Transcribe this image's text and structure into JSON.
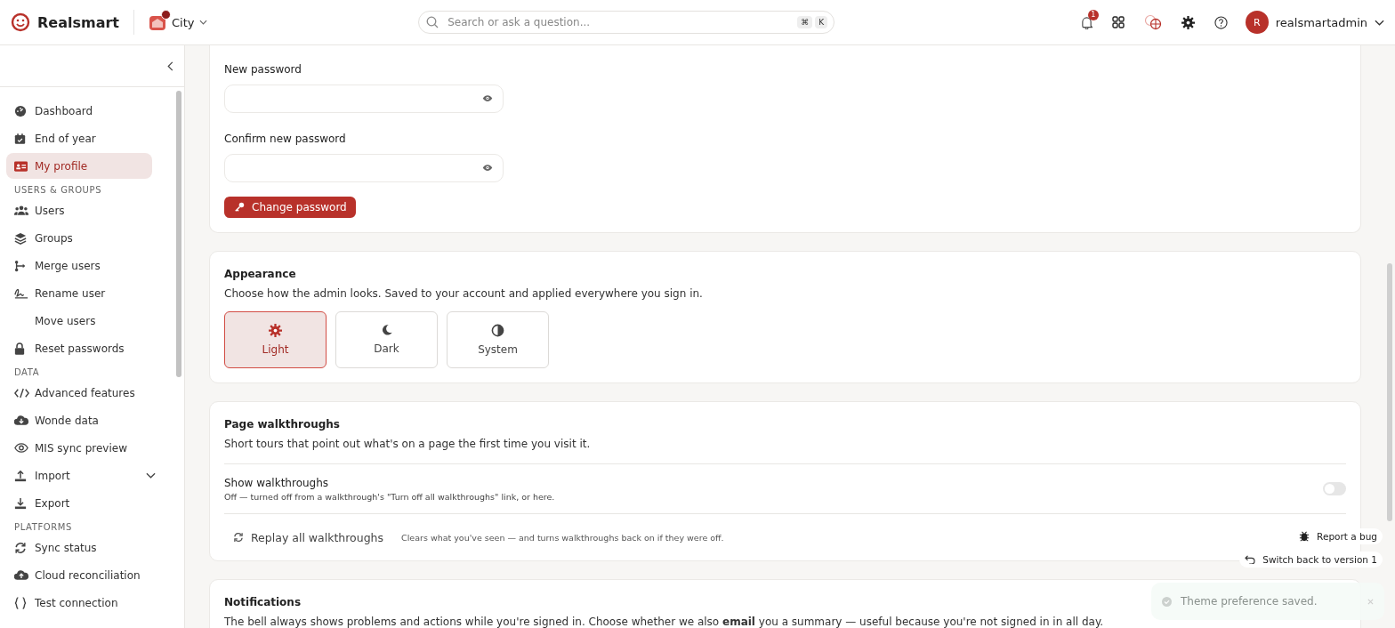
{
  "brand": {
    "name": "Realsmart"
  },
  "school": {
    "name": "City",
    "alert": true
  },
  "search": {
    "placeholder": "Search or ask a question...",
    "keys": [
      "⌘",
      "K"
    ]
  },
  "notifications": {
    "count": "1"
  },
  "user": {
    "initial": "R",
    "name": "realsmartadmin"
  },
  "sidebar": {
    "sections": [
      {
        "items": [
          {
            "label": "Dashboard",
            "kind": "link",
            "selected": false
          },
          {
            "label": "End of year",
            "kind": "link",
            "selected": false
          },
          {
            "label": "My profile",
            "kind": "link",
            "selected": true
          }
        ]
      },
      {
        "heading": "USERS & GROUPS",
        "items": [
          {
            "label": "Users",
            "kind": "link",
            "selected": false
          },
          {
            "label": "Groups",
            "kind": "link",
            "selected": false
          },
          {
            "label": "Merge users",
            "kind": "link",
            "selected": false
          },
          {
            "label": "Rename user",
            "kind": "link",
            "selected": false
          },
          {
            "label": "Move users",
            "kind": "link",
            "selected": false
          },
          {
            "label": "Reset passwords",
            "kind": "link",
            "selected": false
          }
        ]
      },
      {
        "heading": "DATA",
        "items": [
          {
            "label": "Advanced features",
            "kind": "link",
            "selected": false
          },
          {
            "label": "Wonde data",
            "kind": "link",
            "selected": false
          },
          {
            "label": "MIS sync preview",
            "kind": "link",
            "selected": false
          },
          {
            "label": "Import",
            "kind": "group",
            "selected": false
          },
          {
            "label": "Export",
            "kind": "link",
            "selected": false
          }
        ]
      },
      {
        "heading": "PLATFORMS",
        "items": [
          {
            "label": "Sync status",
            "kind": "link",
            "selected": false
          },
          {
            "label": "Cloud reconciliation",
            "kind": "link",
            "selected": false
          },
          {
            "label": "Test connection",
            "kind": "link",
            "selected": false
          }
        ]
      }
    ]
  },
  "password": {
    "fields": [
      {
        "label": "New password"
      },
      {
        "label": "Confirm new password"
      }
    ],
    "button": "Change password"
  },
  "appearance": {
    "title": "Appearance",
    "description": "Choose how the admin looks. Saved to your account and applied everywhere you sign in.",
    "options": [
      {
        "label": "Light",
        "selected": true
      },
      {
        "label": "Dark",
        "selected": false
      },
      {
        "label": "System",
        "selected": false
      }
    ]
  },
  "walkthroughs": {
    "title": "Page walkthroughs",
    "description": "Short tours that point out what's on a page the first time you visit it.",
    "setting": {
      "label": "Show walkthroughs",
      "description": "Off — turned off from a walkthrough's \"Turn off all walkthroughs\" link, or here.",
      "on": false
    },
    "replay": {
      "label": "Replay all walkthroughs",
      "note": "Clears what you've seen — and turns walkthroughs back on if they were off."
    }
  },
  "notifications_card": {
    "title": "Notifications",
    "description": "The bell always shows problems and actions while you're signed in. Choose whether we also **email** you a summary — useful because you're not signed in in all day."
  },
  "floating": {
    "report_bug": "Report a bug",
    "switch_back": "Switch back to version 1"
  },
  "toast": {
    "message": "Theme preference saved."
  }
}
